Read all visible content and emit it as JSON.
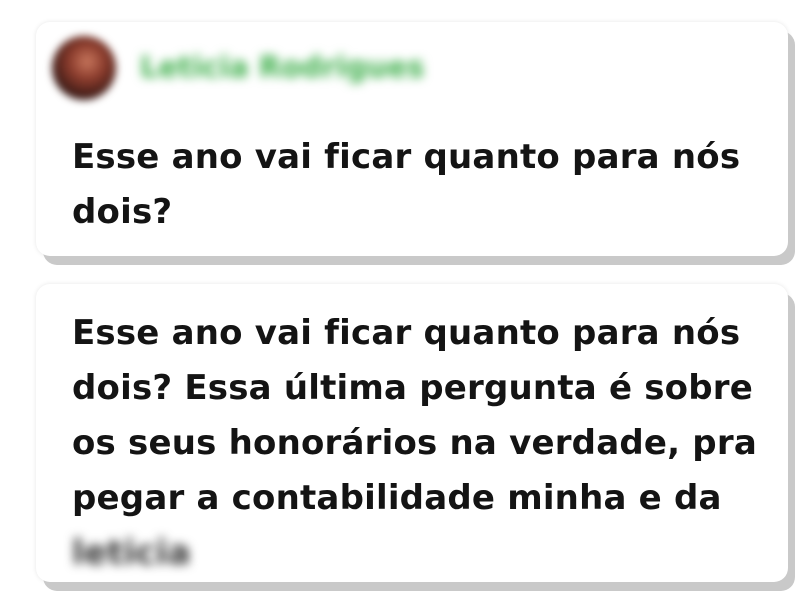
{
  "comment1": {
    "author_name": "Leticia Rodrigues",
    "text": "Esse ano vai ficar quanto para nós dois?"
  },
  "comment2": {
    "text": "Esse ano vai ficar quanto para nós dois? Essa última pergunta é sobre os seus honorários na verdade, pra pegar a contabilidade minha e da",
    "blurred_name": "leticia"
  },
  "colors": {
    "author_name": "#3eaf4b",
    "text": "#141414",
    "card_shadow": "#c9c9c9"
  }
}
